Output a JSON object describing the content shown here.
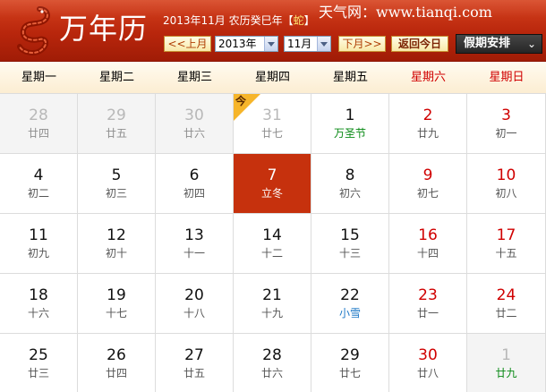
{
  "header": {
    "title": "万年历",
    "month_info_prefix": "2013年11月 农历癸巳年【",
    "zodiac": "蛇",
    "month_info_suffix": "】",
    "site": "天气网：www.tianqi.com",
    "prev_label": "<<上月",
    "next_label": "下月>>",
    "today_label": "返回今日",
    "year_value": "2013年",
    "month_value": "11月",
    "holiday_label": "假期安排",
    "holiday_chevron": "⌄"
  },
  "weekdays": [
    "星期一",
    "星期二",
    "星期三",
    "星期四",
    "星期五",
    "星期六",
    "星期日"
  ],
  "today_flag": "今",
  "colors": {
    "header_red": "#c6310d",
    "weekend_red": "#d00000",
    "festival_green": "#0a8a16",
    "solar_term_blue": "#1f79c7"
  },
  "weeks": [
    [
      {
        "day": "28",
        "lunar": "廿四",
        "type": "other"
      },
      {
        "day": "29",
        "lunar": "廿五",
        "type": "other"
      },
      {
        "day": "30",
        "lunar": "廿六",
        "type": "other"
      },
      {
        "day": "31",
        "lunar": "廿七",
        "type": "other-white",
        "flag": true
      },
      {
        "day": "1",
        "lunar": "万圣节",
        "type": "festival"
      },
      {
        "day": "2",
        "lunar": "廿九",
        "type": "normal"
      },
      {
        "day": "3",
        "lunar": "初一",
        "type": "normal"
      }
    ],
    [
      {
        "day": "4",
        "lunar": "初二",
        "type": "normal"
      },
      {
        "day": "5",
        "lunar": "初三",
        "type": "normal"
      },
      {
        "day": "6",
        "lunar": "初四",
        "type": "normal"
      },
      {
        "day": "7",
        "lunar": "立冬",
        "type": "today"
      },
      {
        "day": "8",
        "lunar": "初六",
        "type": "normal"
      },
      {
        "day": "9",
        "lunar": "初七",
        "type": "normal"
      },
      {
        "day": "10",
        "lunar": "初八",
        "type": "normal"
      }
    ],
    [
      {
        "day": "11",
        "lunar": "初九",
        "type": "normal"
      },
      {
        "day": "12",
        "lunar": "初十",
        "type": "normal"
      },
      {
        "day": "13",
        "lunar": "十一",
        "type": "normal"
      },
      {
        "day": "14",
        "lunar": "十二",
        "type": "normal"
      },
      {
        "day": "15",
        "lunar": "十三",
        "type": "normal"
      },
      {
        "day": "16",
        "lunar": "十四",
        "type": "normal"
      },
      {
        "day": "17",
        "lunar": "十五",
        "type": "normal"
      }
    ],
    [
      {
        "day": "18",
        "lunar": "十六",
        "type": "normal"
      },
      {
        "day": "19",
        "lunar": "十七",
        "type": "normal"
      },
      {
        "day": "20",
        "lunar": "十八",
        "type": "normal"
      },
      {
        "day": "21",
        "lunar": "十九",
        "type": "normal"
      },
      {
        "day": "22",
        "lunar": "小雪",
        "type": "solarterm"
      },
      {
        "day": "23",
        "lunar": "廿一",
        "type": "normal"
      },
      {
        "day": "24",
        "lunar": "廿二",
        "type": "normal"
      }
    ],
    [
      {
        "day": "25",
        "lunar": "廿三",
        "type": "normal"
      },
      {
        "day": "26",
        "lunar": "廿四",
        "type": "normal"
      },
      {
        "day": "27",
        "lunar": "廿五",
        "type": "normal"
      },
      {
        "day": "28",
        "lunar": "廿六",
        "type": "normal"
      },
      {
        "day": "29",
        "lunar": "廿七",
        "type": "normal"
      },
      {
        "day": "30",
        "lunar": "廿八",
        "type": "normal"
      },
      {
        "day": "1",
        "lunar": "廿九",
        "type": "other-festival"
      }
    ]
  ]
}
